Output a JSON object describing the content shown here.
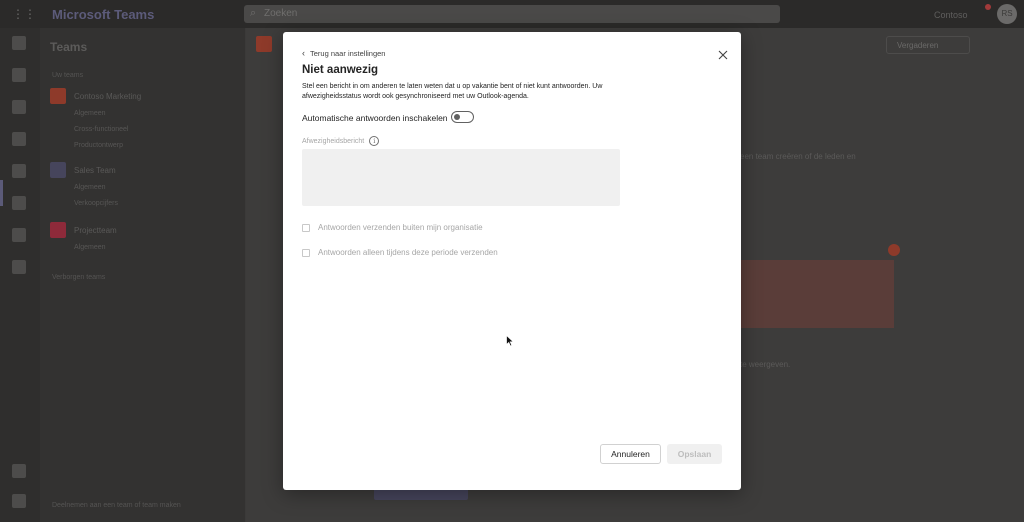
{
  "app": {
    "title": "Microsoft Teams",
    "search_placeholder": "Zoeken",
    "org_name": "Contoso",
    "avatar_initials": "RS",
    "accent": "#5b5fc7"
  },
  "sidebar": {
    "title": "Teams",
    "section_label": "Uw teams",
    "teams": [
      {
        "name": "Contoso Marketing",
        "color": "#8e3a2a",
        "channels": [
          "Algemeen",
          "Cross-functioneel",
          "Productontwerp"
        ]
      },
      {
        "name": "Sales Team",
        "color": "#46455c",
        "channels": [
          "Algemeen",
          "Verkoopcijfers"
        ]
      },
      {
        "name": "Projectteam",
        "color": "#8e2a3a",
        "channels": [
          "Algemeen"
        ]
      }
    ],
    "hidden_label": "Verborgen teams",
    "footer": "Deelnemen aan een team of team maken"
  },
  "main": {
    "meeting_button": "Vergaderen",
    "side_text_1": "een team creëren of de leden en",
    "side_text_2": "te weergeven."
  },
  "modal": {
    "back_label": "Terug naar instellingen",
    "title": "Niet aanwezig",
    "description": "Stel een bericht in om anderen te laten weten dat u op vakantie bent of niet kunt antwoorden. Uw afwezigheidsstatus wordt ook gesynchroniseerd met uw Outlook-agenda.",
    "toggle_label": "Automatische antwoorden inschakelen",
    "toggle_on": false,
    "message_label": "Afwezigheidsbericht",
    "message_value": "",
    "checkbox_external": "Antwoorden verzenden buiten mijn organisatie",
    "checkbox_period": "Antwoorden alleen tijdens deze periode verzenden",
    "cancel_label": "Annuleren",
    "save_label": "Opslaan"
  }
}
